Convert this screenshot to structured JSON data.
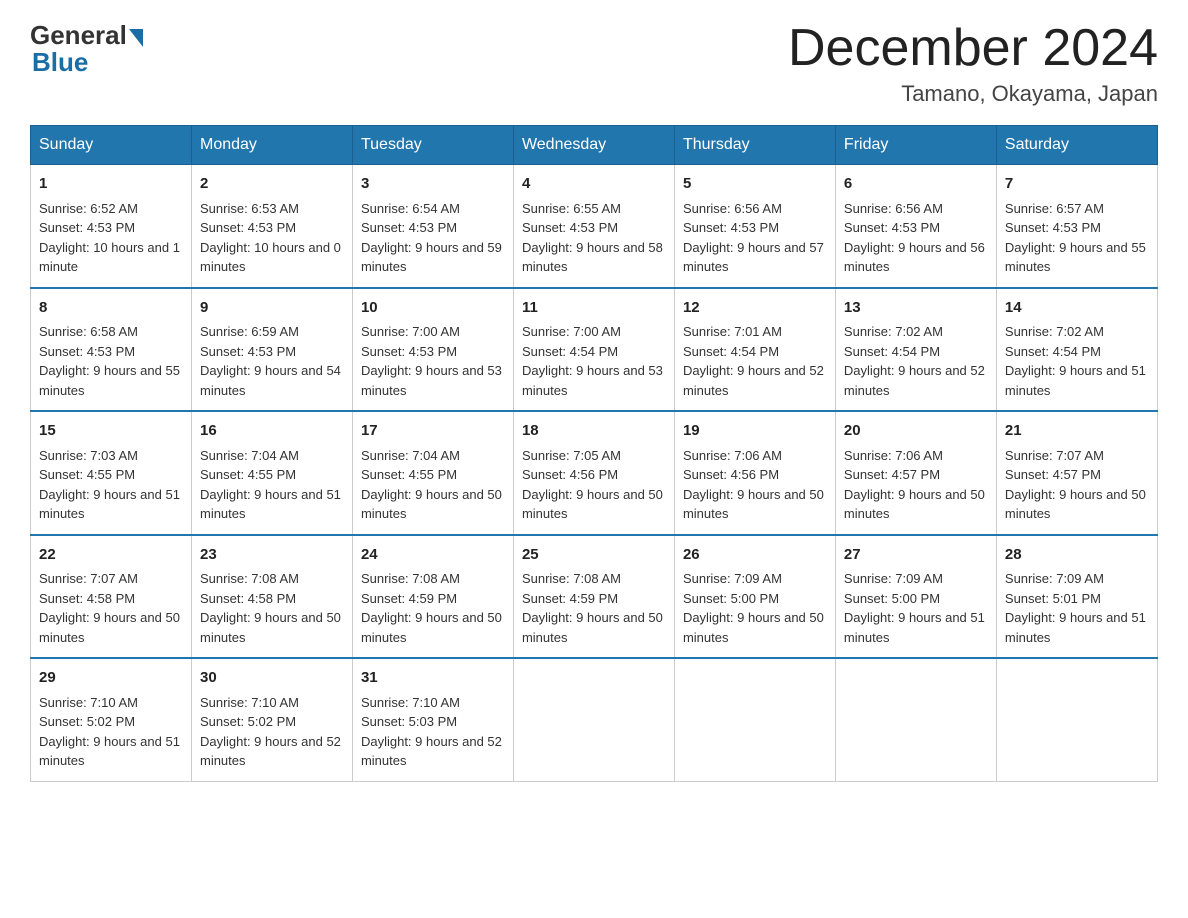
{
  "header": {
    "logo_general": "General",
    "logo_blue": "Blue",
    "month_title": "December 2024",
    "location": "Tamano, Okayama, Japan"
  },
  "days_of_week": [
    "Sunday",
    "Monday",
    "Tuesday",
    "Wednesday",
    "Thursday",
    "Friday",
    "Saturday"
  ],
  "weeks": [
    [
      {
        "day": "1",
        "sunrise": "6:52 AM",
        "sunset": "4:53 PM",
        "daylight": "10 hours and 1 minute."
      },
      {
        "day": "2",
        "sunrise": "6:53 AM",
        "sunset": "4:53 PM",
        "daylight": "10 hours and 0 minutes."
      },
      {
        "day": "3",
        "sunrise": "6:54 AM",
        "sunset": "4:53 PM",
        "daylight": "9 hours and 59 minutes."
      },
      {
        "day": "4",
        "sunrise": "6:55 AM",
        "sunset": "4:53 PM",
        "daylight": "9 hours and 58 minutes."
      },
      {
        "day": "5",
        "sunrise": "6:56 AM",
        "sunset": "4:53 PM",
        "daylight": "9 hours and 57 minutes."
      },
      {
        "day": "6",
        "sunrise": "6:56 AM",
        "sunset": "4:53 PM",
        "daylight": "9 hours and 56 minutes."
      },
      {
        "day": "7",
        "sunrise": "6:57 AM",
        "sunset": "4:53 PM",
        "daylight": "9 hours and 55 minutes."
      }
    ],
    [
      {
        "day": "8",
        "sunrise": "6:58 AM",
        "sunset": "4:53 PM",
        "daylight": "9 hours and 55 minutes."
      },
      {
        "day": "9",
        "sunrise": "6:59 AM",
        "sunset": "4:53 PM",
        "daylight": "9 hours and 54 minutes."
      },
      {
        "day": "10",
        "sunrise": "7:00 AM",
        "sunset": "4:53 PM",
        "daylight": "9 hours and 53 minutes."
      },
      {
        "day": "11",
        "sunrise": "7:00 AM",
        "sunset": "4:54 PM",
        "daylight": "9 hours and 53 minutes."
      },
      {
        "day": "12",
        "sunrise": "7:01 AM",
        "sunset": "4:54 PM",
        "daylight": "9 hours and 52 minutes."
      },
      {
        "day": "13",
        "sunrise": "7:02 AM",
        "sunset": "4:54 PM",
        "daylight": "9 hours and 52 minutes."
      },
      {
        "day": "14",
        "sunrise": "7:02 AM",
        "sunset": "4:54 PM",
        "daylight": "9 hours and 51 minutes."
      }
    ],
    [
      {
        "day": "15",
        "sunrise": "7:03 AM",
        "sunset": "4:55 PM",
        "daylight": "9 hours and 51 minutes."
      },
      {
        "day": "16",
        "sunrise": "7:04 AM",
        "sunset": "4:55 PM",
        "daylight": "9 hours and 51 minutes."
      },
      {
        "day": "17",
        "sunrise": "7:04 AM",
        "sunset": "4:55 PM",
        "daylight": "9 hours and 50 minutes."
      },
      {
        "day": "18",
        "sunrise": "7:05 AM",
        "sunset": "4:56 PM",
        "daylight": "9 hours and 50 minutes."
      },
      {
        "day": "19",
        "sunrise": "7:06 AM",
        "sunset": "4:56 PM",
        "daylight": "9 hours and 50 minutes."
      },
      {
        "day": "20",
        "sunrise": "7:06 AM",
        "sunset": "4:57 PM",
        "daylight": "9 hours and 50 minutes."
      },
      {
        "day": "21",
        "sunrise": "7:07 AM",
        "sunset": "4:57 PM",
        "daylight": "9 hours and 50 minutes."
      }
    ],
    [
      {
        "day": "22",
        "sunrise": "7:07 AM",
        "sunset": "4:58 PM",
        "daylight": "9 hours and 50 minutes."
      },
      {
        "day": "23",
        "sunrise": "7:08 AM",
        "sunset": "4:58 PM",
        "daylight": "9 hours and 50 minutes."
      },
      {
        "day": "24",
        "sunrise": "7:08 AM",
        "sunset": "4:59 PM",
        "daylight": "9 hours and 50 minutes."
      },
      {
        "day": "25",
        "sunrise": "7:08 AM",
        "sunset": "4:59 PM",
        "daylight": "9 hours and 50 minutes."
      },
      {
        "day": "26",
        "sunrise": "7:09 AM",
        "sunset": "5:00 PM",
        "daylight": "9 hours and 50 minutes."
      },
      {
        "day": "27",
        "sunrise": "7:09 AM",
        "sunset": "5:00 PM",
        "daylight": "9 hours and 51 minutes."
      },
      {
        "day": "28",
        "sunrise": "7:09 AM",
        "sunset": "5:01 PM",
        "daylight": "9 hours and 51 minutes."
      }
    ],
    [
      {
        "day": "29",
        "sunrise": "7:10 AM",
        "sunset": "5:02 PM",
        "daylight": "9 hours and 51 minutes."
      },
      {
        "day": "30",
        "sunrise": "7:10 AM",
        "sunset": "5:02 PM",
        "daylight": "9 hours and 52 minutes."
      },
      {
        "day": "31",
        "sunrise": "7:10 AM",
        "sunset": "5:03 PM",
        "daylight": "9 hours and 52 minutes."
      },
      null,
      null,
      null,
      null
    ]
  ],
  "labels": {
    "sunrise": "Sunrise:",
    "sunset": "Sunset:",
    "daylight": "Daylight:"
  }
}
